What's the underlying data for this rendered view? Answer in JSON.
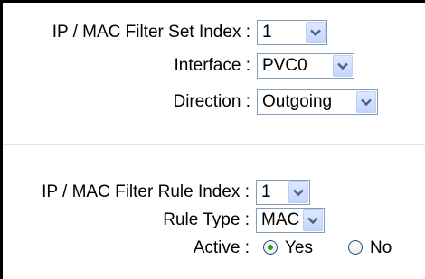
{
  "filter_set": {
    "set_index_label": "IP / MAC Filter Set Index :",
    "set_index_value": "1",
    "interface_label": "Interface :",
    "interface_value": "PVC0",
    "direction_label": "Direction :",
    "direction_value": "Outgoing"
  },
  "filter_rule": {
    "rule_index_label": "IP / MAC Filter Rule Index :",
    "rule_index_value": "1",
    "rule_type_label": "Rule Type :",
    "rule_type_value": "MAC",
    "active_label": "Active :",
    "active_options": [
      "Yes",
      "No"
    ],
    "active_selected": "Yes"
  },
  "icons": {
    "dropdown": "chevron-down-icon",
    "radio": "radio-circle"
  },
  "colors": {
    "select_border": "#7f9db9",
    "dropdown_button": "#c3d5fd",
    "radio_dot": "#21a121",
    "separator": "#e4e4e4"
  }
}
